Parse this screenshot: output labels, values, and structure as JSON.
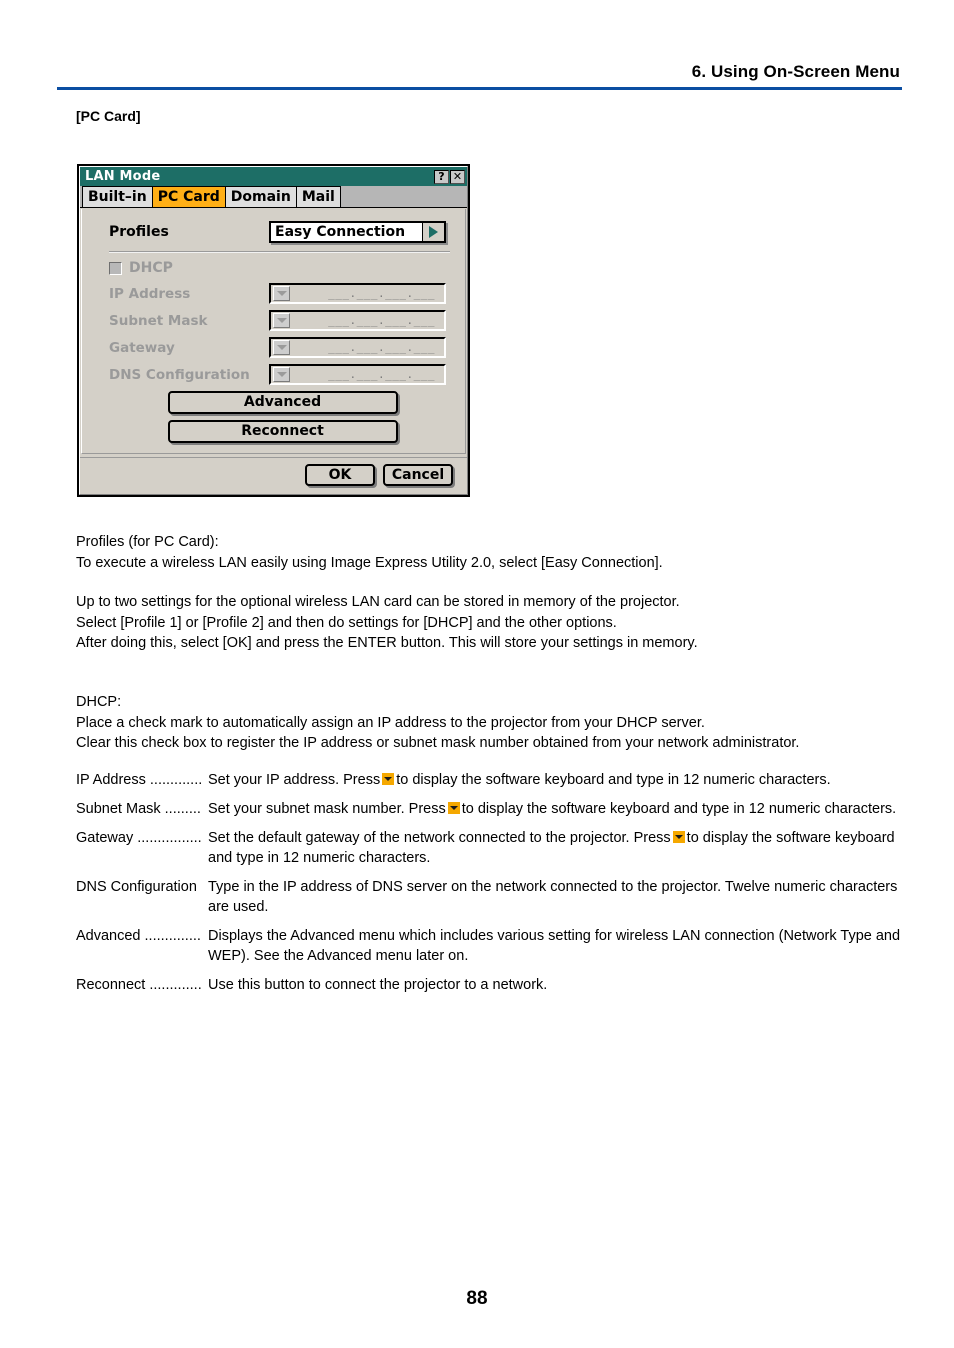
{
  "header": {
    "chapter_title": "6. Using On-Screen Menu",
    "rule_color": "#0b4ea2"
  },
  "section_label": "[PC Card]",
  "dialog": {
    "title": "LAN Mode",
    "titlebar_color": "#1d6e66",
    "help_button": "?",
    "close_button": "✕",
    "tabs": [
      {
        "label": "Built–in",
        "active": false
      },
      {
        "label": "PC Card",
        "active": true
      },
      {
        "label": "Domain",
        "active": false
      },
      {
        "label": "Mail",
        "active": false
      }
    ],
    "active_tab_color": "#ffaf16",
    "profiles": {
      "label": "Profiles",
      "value": "Easy Connection"
    },
    "dhcp": {
      "label": "DHCP",
      "checked": false
    },
    "fields": [
      {
        "label": "IP Address",
        "mask": "___.___.___.___"
      },
      {
        "label": "Subnet Mask",
        "mask": "___.___.___.___"
      },
      {
        "label": "Gateway",
        "mask": "___.___.___.___"
      },
      {
        "label": "DNS Configuration",
        "mask": "___.___.___.___"
      }
    ],
    "advanced_button": "Advanced",
    "reconnect_button": "Reconnect",
    "ok_button": "OK",
    "cancel_button": "Cancel"
  },
  "text": {
    "para_profiles_line1": "Profiles (for PC Card):",
    "para_profiles_line2": "To execute a wireless LAN easily using Image Express Utility 2.0, select [Easy Connection].",
    "para_memory_line1": "Up to two settings for the optional wireless LAN card can be stored in memory of the projector.",
    "para_memory_line2": "Select [Profile 1] or [Profile 2] and then do settings for [DHCP] and the other options.",
    "para_memory_line3": "After doing this, select [OK] and press the ENTER button. This will store your settings in memory.",
    "para_dhcp_line1": "DHCP:",
    "para_dhcp_line2": "Place a check mark to automatically assign an IP address to the projector from your DHCP server.",
    "para_dhcp_line3": "Clear this check box to register the IP address or subnet mask number obtained from your network administrator."
  },
  "definitions": [
    {
      "term": "IP Address .............",
      "desc_before": "Set your IP address. Press",
      "has_arrow": true,
      "desc_after": "to display the software keyboard and type in 12 numeric characters."
    },
    {
      "term": "Subnet Mask .........",
      "desc_before": "Set your subnet mask number. Press",
      "has_arrow": true,
      "desc_after": "to display the software keyboard and type in 12 numeric characters."
    },
    {
      "term": "Gateway ................",
      "desc_before": "Set the default gateway of the network connected to the projector. Press",
      "has_arrow": true,
      "desc_after": "to display the software keyboard and type in 12 numeric characters."
    },
    {
      "term": "DNS Configuration",
      "desc_before": "Type in the IP address of DNS server on the network connected to the projector. Twelve numeric characters are used.",
      "has_arrow": false,
      "desc_after": ""
    },
    {
      "term": "Advanced ..............",
      "desc_before": "Displays the Advanced menu which includes various setting for wireless LAN connection (Network Type and WEP). See the Advanced menu later on.",
      "has_arrow": false,
      "desc_after": ""
    },
    {
      "term": "Reconnect .............",
      "desc_before": "Use this button to connect the projector to a network.",
      "has_arrow": false,
      "desc_after": ""
    }
  ],
  "page_number": "88"
}
